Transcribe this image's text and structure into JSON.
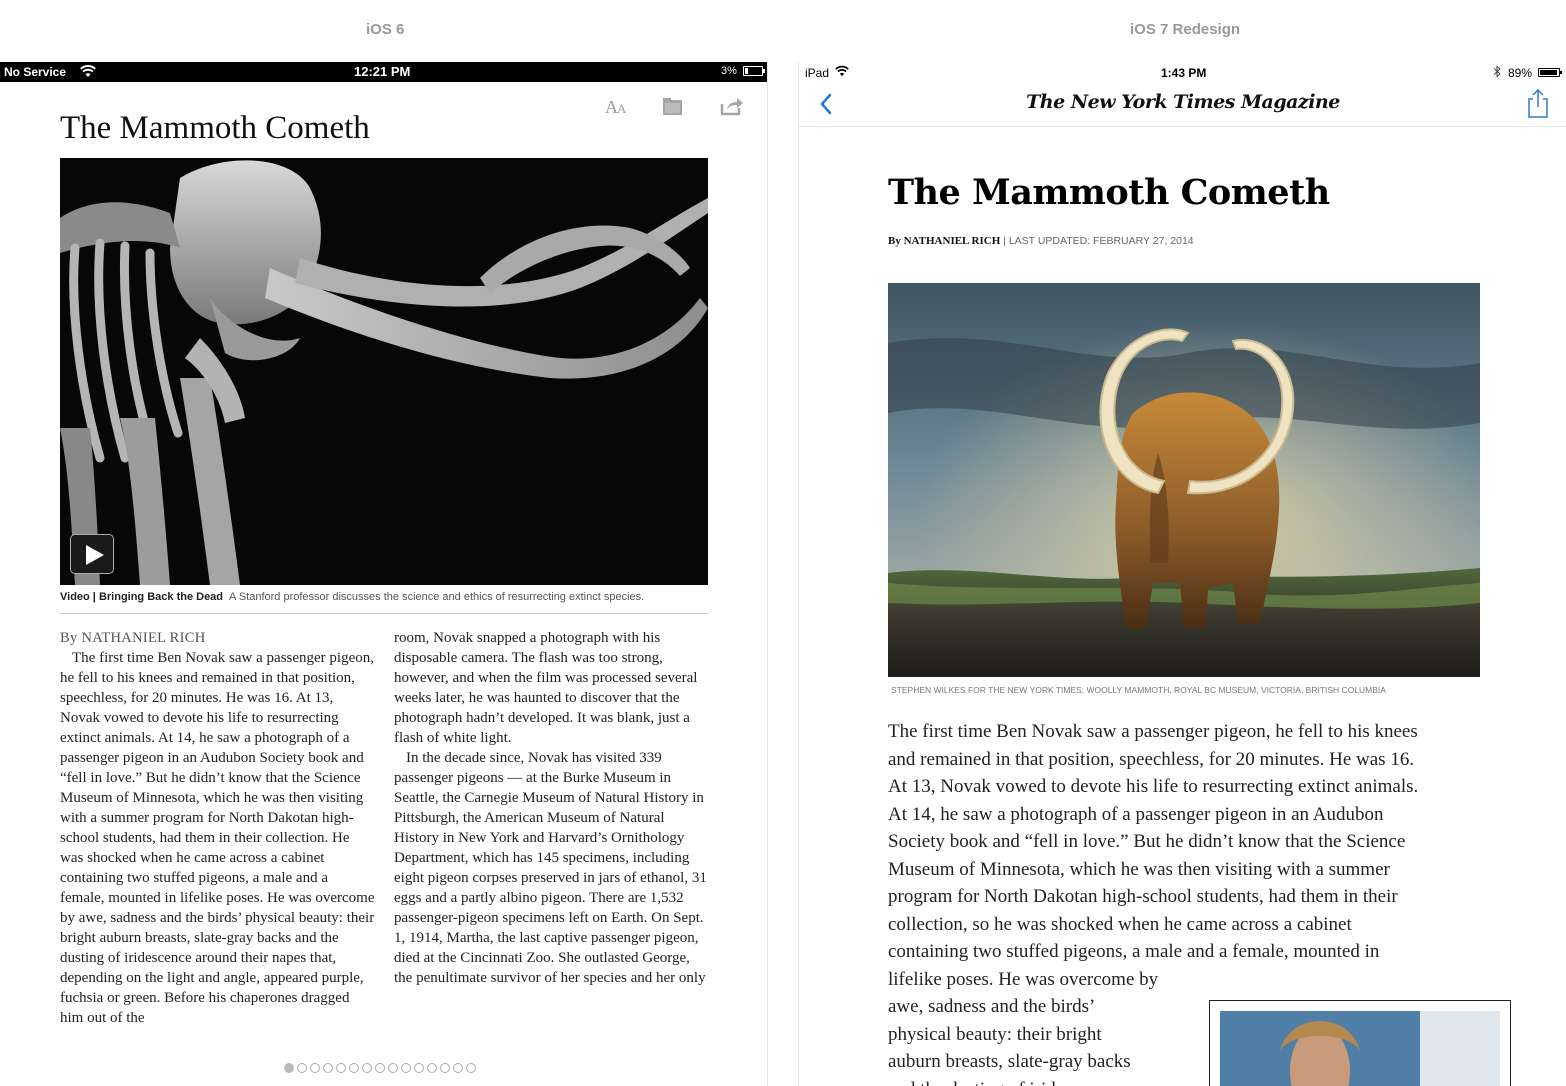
{
  "labels": {
    "left": "iOS 6",
    "right": "iOS 7 Redesign"
  },
  "ios6": {
    "status": {
      "carrier": "No Service",
      "time": "12:21 PM",
      "battery": "3%"
    },
    "toolbar_icons": [
      "font-size-icon",
      "folder-icon",
      "share-icon"
    ],
    "title": "The Mammoth Cometh",
    "caption": {
      "head": "Video | Bringing Back the Dead",
      "text": "A Stanford professor discusses the science and ethics of resurrecting extinct species."
    },
    "byline": "By NATHANIEL RICH",
    "col1": {
      "p1": "The first time Ben Novak saw a passenger pigeon, he fell to his knees and remained in that position, speechless, for 20 minutes. He was 16. At 13, Novak vowed to devote his life to resurrecting extinct animals. At 14, he saw a photograph of a passenger pigeon in an Audubon Society book and “fell in love.” But he didn’t know that the Science Museum of Minnesota, which he was then visiting with a summer program for North Dakotan high-school students, had them in their collection. He was shocked when he came across a cabinet containing two stuffed pigeons, a male and a female, mounted in lifelike poses. He was overcome by awe, sadness and the birds’ physical beauty: their bright auburn breasts, slate-gray backs and the dusting of iridescence around their napes that, depending on the light and angle, appeared purple, fuchsia or green. Before his chaperones dragged him out of the"
    },
    "col2": {
      "p1": "room, Novak snapped a photograph with his disposable camera. The flash was too strong, however, and when the film was processed several weeks later, he was haunted to discover that the photograph hadn’t developed. It was blank, just a flash of white light.",
      "p2": "In the decade since, Novak has visited 339 passenger pigeons — at the Burke Museum in Seattle, the Carnegie Museum of Natural History in Pittsburgh, the American Museum of Natural History in New York and Harvard’s Ornithology Department, which has 145 specimens, including eight pigeon corpses preserved in jars of ethanol, 31 eggs and a partly albino pigeon. There are 1,532 passenger-pigeon specimens left on Earth. On Sept. 1, 1914, Martha, the last captive passenger pigeon, died at the Cincinnati Zoo. She outlasted George, the penultimate survivor of her species and her only"
    },
    "pages": {
      "total": 15,
      "current": 1
    }
  },
  "ios7": {
    "status": {
      "device": "iPad",
      "time": "1:43 PM",
      "battery": "89%"
    },
    "masthead": "The New York Times Magazine",
    "title": "The Mammoth Cometh",
    "byline_name": "By NATHANIEL RICH",
    "byline_updated": "| LAST UPDATED: FEBRUARY 27, 2014",
    "photo_credit": "STEPHEN WILKES FOR THE NEW YORK TIMES; WOOLLY MAMMOTH, ROYAL BC MUSEUM, VICTORIA, BRITISH COLUMBIA",
    "body_lines": [
      "The first time Ben Novak saw a passenger pigeon, he fell to his knees",
      "and remained in that position, speechless, for 20 minutes. He was 16.",
      "At 13, Novak vowed to devote his life to resurrecting extinct animals.",
      "At 14, he saw a photograph of a passenger pigeon in an Audubon",
      "Society book and “fell in love.” But he didn’t know that the Science",
      "Museum of Minnesota, which he was then visiting with a summer",
      "program for North Dakotan high-school students, had them in their",
      "collection, so he was shocked when he came across a cabinet",
      "containing two stuffed pigeons, a male and a female, mounted in",
      "lifelike poses. He was overcome by",
      "awe, sadness and the birds’",
      "physical beauty: their bright",
      "auburn breasts, slate-gray backs",
      "and the dusting of iridescence"
    ]
  }
}
